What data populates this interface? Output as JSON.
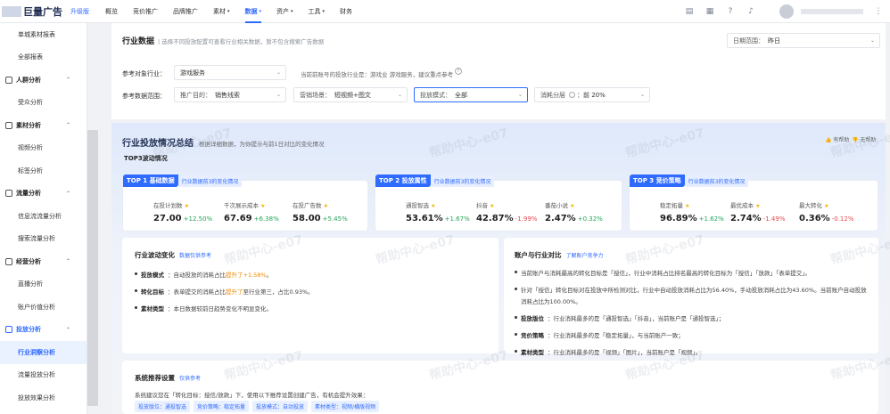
{
  "brand": {
    "name": "巨量广告",
    "version": "升级版"
  },
  "nav": [
    "概览",
    "竞价推广",
    "品牌推广",
    "素材",
    "数据",
    "资产",
    "工具",
    "财务"
  ],
  "nav_active": "数据",
  "nav_dropdown": [
    "素材",
    "数据",
    "资产",
    "工具"
  ],
  "sidebar": {
    "items": [
      {
        "type": "item",
        "label": "单城素材报表"
      },
      {
        "type": "item",
        "label": "全部报表"
      },
      {
        "type": "group",
        "label": "人群分析"
      },
      {
        "type": "item",
        "label": "受众分析"
      },
      {
        "type": "group",
        "label": "素材分析"
      },
      {
        "type": "item",
        "label": "视频分析"
      },
      {
        "type": "item",
        "label": "标签分析"
      },
      {
        "type": "group",
        "label": "流量分析"
      },
      {
        "type": "item",
        "label": "信息流流量分析"
      },
      {
        "type": "item",
        "label": "搜索流量分析"
      },
      {
        "type": "group",
        "label": "经营分析"
      },
      {
        "type": "item",
        "label": "直播分析"
      },
      {
        "type": "item",
        "label": "账户价值分析"
      },
      {
        "type": "group",
        "label": "投放分析",
        "active": true
      },
      {
        "type": "item",
        "label": "行业洞察分析",
        "active": true
      },
      {
        "type": "item",
        "label": "流量投放分析"
      },
      {
        "type": "item",
        "label": "投放效果分析"
      }
    ]
  },
  "header": {
    "title": "行业数据",
    "desc": "| 选择不同投放配置可查看行业相关数据，暂不包含搜索广告数据",
    "date_label": "日期范围：",
    "date_value": "昨日"
  },
  "filters": {
    "industry_label": "参考对象行业：",
    "industry_value": "游戏服务",
    "industry_note": "当前前账号的投放行业是：游戏业 游戏服务，建议重点参考",
    "scope_label": "参考数据范围：",
    "goal_label": "推广目的：",
    "goal_value": "销售线索",
    "scene_label": "营销场景：",
    "scene_value": "短视频+图文",
    "mode_label": "投放模式：",
    "mode_value": "全部",
    "tier_label": "消耗分层",
    "tier_value": "：前 20%"
  },
  "summary": {
    "title": "行业投放情况总结",
    "subtitle": "根据详细数据，为你提示与前1日对比的变化情况",
    "top_heading": "TOP3波动情况",
    "help1": "有帮助",
    "help2": "无帮助",
    "cards": [
      {
        "tag": "TOP 1 基础数据",
        "note": "行业数据前3的变化情况",
        "metrics": [
          {
            "label": "在投计划数",
            "value": "27.00",
            "delta": "+12.50%",
            "dir": "up"
          },
          {
            "label": "千次展示成本",
            "value": "67.69",
            "delta": "+6.38%",
            "dir": "up"
          },
          {
            "label": "在投广告数",
            "value": "58.00",
            "delta": "+5.45%",
            "dir": "up"
          }
        ]
      },
      {
        "tag": "TOP 2 投放属性",
        "note": "行业数据前3的变化情况",
        "metrics": [
          {
            "label": "通投智选",
            "value": "53.61%",
            "delta": "+1.67%",
            "dir": "up"
          },
          {
            "label": "抖音",
            "value": "42.87%",
            "delta": "-1.99%",
            "dir": "down"
          },
          {
            "label": "番茄小说",
            "value": "2.47%",
            "delta": "+0.32%",
            "dir": "up"
          }
        ]
      },
      {
        "tag": "TOP 3 竞价策略",
        "note": "行业数据前3的变化情况",
        "metrics": [
          {
            "label": "稳定拓量",
            "value": "96.89%",
            "delta": "+1.62%",
            "dir": "up"
          },
          {
            "label": "最优成本",
            "value": "2.74%",
            "delta": "-1.49%",
            "dir": "down"
          },
          {
            "label": "最大转化",
            "value": "0.36%",
            "delta": "-0.12%",
            "dir": "down"
          }
        ]
      }
    ]
  },
  "fluct": {
    "title": "行业波动变化",
    "tag": "数据仅供参考",
    "rows": [
      {
        "k": "投放模式",
        "pre": "：自动投放的消耗占比",
        "hl": "提升了+1.58%",
        "post": "。"
      },
      {
        "k": "转化目标",
        "pre": "：表单提交的消耗占比",
        "hl": "提升了",
        "post": "至行业第三，占比0.93%。"
      },
      {
        "k": "素材类型",
        "pre": "：本日数据较前日趋势变化不明显变化。",
        "hl": "",
        "post": ""
      }
    ]
  },
  "compare": {
    "title": "账户与行业对比",
    "tag": "了解账户竞争力",
    "rows": [
      {
        "k": "",
        "t": "当前账户与消耗最高的转化目标是「授信」，行业中消耗占比排名最高的转化目标为「授信」「放款」「表单提交」。"
      },
      {
        "k": "",
        "t": "针对「授信」转化目标对在投放中所检测对比，行业中自动投放消耗占比为56.40%，手动投放消耗占比为43.60%。当前账户自动投放"
      },
      {
        "k": "",
        "t": "消耗占比为100.00%。"
      },
      {
        "k": "投放版位",
        "t": "：行业消耗最多的是「通投智选」「抖音」，当前账户是「通投智选」；"
      },
      {
        "k": "竞价策略",
        "t": "：行业消耗最多的是「稳定拓量」，与当前账户一致；"
      },
      {
        "k": "素材类型",
        "t": "：行业消耗最多的是「视频」「图片」，当前账户是「视频」。"
      }
    ]
  },
  "rec": {
    "title": "系统推荐设置",
    "tag": "仅供参考",
    "desc": "系统建议您在「转化目标：授信/放款」下，使用以下推荐设置创建广告，有机会提升效果：",
    "chips": [
      "投放版位：通投智选",
      "竞价策略：稳定拓量",
      "投放模式：自动投放",
      "素材类型：视频/横版视频"
    ]
  },
  "watermark": "帮助中心-e07"
}
